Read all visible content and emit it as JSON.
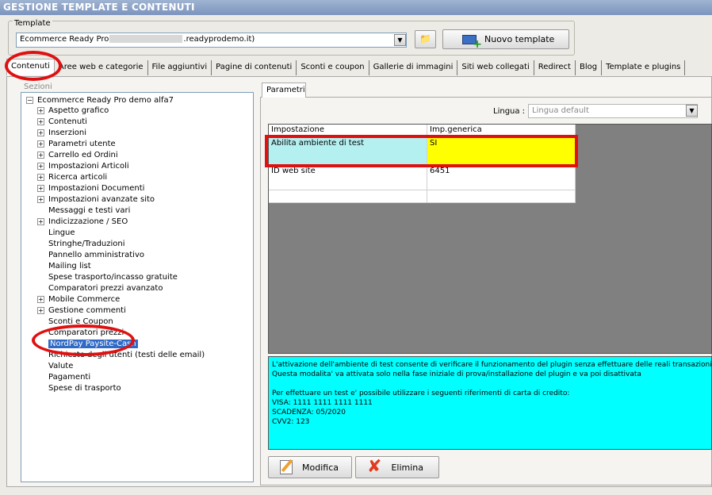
{
  "window": {
    "title": "GESTIONE TEMPLATE E CONTENUTI"
  },
  "template": {
    "label": "Template",
    "value_start": "Ecommerce Ready Pro",
    "value_end": ".readyprodemo.it)",
    "new_button": "Nuovo template"
  },
  "tabs": [
    {
      "label": "Contenuti"
    },
    {
      "label": "Aree web e categorie"
    },
    {
      "label": "File aggiuntivi"
    },
    {
      "label": "Pagine di contenuti"
    },
    {
      "label": "Sconti e coupon"
    },
    {
      "label": "Gallerie di immagini"
    },
    {
      "label": "Siti web collegati"
    },
    {
      "label": "Redirect"
    },
    {
      "label": "Blog"
    },
    {
      "label": "Template e plugins"
    }
  ],
  "tree": {
    "legend": "Sezioni",
    "root": "Ecommerce Ready Pro demo alfa7",
    "items": [
      {
        "label": "Aspetto grafico",
        "expandable": true
      },
      {
        "label": "Contenuti",
        "expandable": true
      },
      {
        "label": "Inserzioni",
        "expandable": true
      },
      {
        "label": "Parametri utente",
        "expandable": true
      },
      {
        "label": "Carrello ed Ordini",
        "expandable": true
      },
      {
        "label": "Impostazioni Articoli",
        "expandable": true
      },
      {
        "label": "Ricerca articoli",
        "expandable": true
      },
      {
        "label": "Impostazioni Documenti",
        "expandable": true
      },
      {
        "label": "Impostazioni avanzate sito",
        "expandable": true
      },
      {
        "label": "Messaggi e testi vari",
        "expandable": false
      },
      {
        "label": "Indicizzazione / SEO",
        "expandable": true
      },
      {
        "label": "Lingue",
        "expandable": false
      },
      {
        "label": "Stringhe/Traduzioni",
        "expandable": false
      },
      {
        "label": "Pannello amministrativo",
        "expandable": false
      },
      {
        "label": "Mailing list",
        "expandable": false
      },
      {
        "label": "Spese trasporto/incasso gratuite",
        "expandable": false
      },
      {
        "label": "Comparatori prezzi avanzato",
        "expandable": false
      },
      {
        "label": "Mobile Commerce",
        "expandable": true
      },
      {
        "label": "Gestione commenti",
        "expandable": true
      },
      {
        "label": "Sconti e Coupon",
        "expandable": false
      },
      {
        "label": "Comparatori prezzi",
        "expandable": false
      },
      {
        "label": "NordPay Paysite-Cash",
        "expandable": false,
        "selected": true
      },
      {
        "label": "Richieste degli utenti (testi delle email)",
        "expandable": false
      },
      {
        "label": "Valute",
        "expandable": false
      },
      {
        "label": "Pagamenti",
        "expandable": false
      },
      {
        "label": "Spese di trasporto",
        "expandable": false
      }
    ]
  },
  "params": {
    "tab": "Parametri",
    "language_label": "Lingua :",
    "language_value": "Lingua default",
    "columns": [
      "Impostazione",
      "Imp.generica"
    ],
    "rows": [
      {
        "setting": "Abilita ambiente di test",
        "value": "SI"
      },
      {
        "setting": "ID web site",
        "value": "6451"
      },
      {
        "setting": "",
        "value": ""
      }
    ],
    "info_lines": [
      "L'attivazione dell'ambiente di test consente di verificare il funzionamento del plugin senza effettuare delle reali transazioni.",
      "Questa modalita' va attivata solo nella fase iniziale di prova/installazione del plugin e va poi disattivata",
      "",
      "Per effettuare un test e' possibile utilizzare i seguenti riferimenti di carta di credito:",
      "VISA: 1111 1111 1111 1111",
      "SCADENZA: 05/2020",
      "CVV2: 123"
    ],
    "modify_button": "Modifica",
    "delete_button": "Elimina"
  },
  "colors": {
    "highlight_ring": "#e01010",
    "selected_row_setting": "#b4f0f0",
    "selected_row_value": "#ffff00",
    "info_background": "#00ffff"
  }
}
